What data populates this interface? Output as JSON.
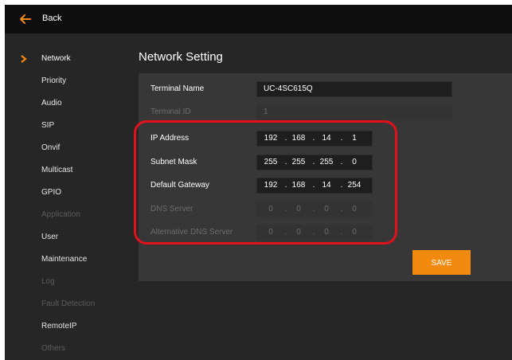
{
  "topbar": {
    "back_label": "Back"
  },
  "sidebar": {
    "items": [
      {
        "label": "Network",
        "state": "active"
      },
      {
        "label": "Priority",
        "state": "normal"
      },
      {
        "label": "Audio",
        "state": "normal"
      },
      {
        "label": "SIP",
        "state": "normal"
      },
      {
        "label": "Onvif",
        "state": "normal"
      },
      {
        "label": "Multicast",
        "state": "normal"
      },
      {
        "label": "GPIO",
        "state": "normal"
      },
      {
        "label": "Application",
        "state": "disabled"
      },
      {
        "label": "User",
        "state": "normal"
      },
      {
        "label": "Maintenance",
        "state": "normal"
      },
      {
        "label": "Log",
        "state": "disabled"
      },
      {
        "label": "Fault Detection",
        "state": "disabled"
      },
      {
        "label": "RemoteIP",
        "state": "normal"
      },
      {
        "label": "Others",
        "state": "disabled"
      }
    ]
  },
  "main": {
    "title": "Network Setting",
    "terminal_name": {
      "label": "Terminal Name",
      "value": "UC-4SC615Q"
    },
    "terminal_id": {
      "label": "Terminal ID",
      "value": "1"
    },
    "ip_address": {
      "label": "IP Address",
      "octets": [
        "192",
        "168",
        "14",
        "1"
      ]
    },
    "subnet_mask": {
      "label": "Subnet Mask",
      "octets": [
        "255",
        "255",
        "255",
        "0"
      ]
    },
    "default_gateway": {
      "label": "Default Gateway",
      "octets": [
        "192",
        "168",
        "14",
        "254"
      ]
    },
    "dns_server": {
      "label": "DNS Server",
      "octets": [
        "0",
        "0",
        "0",
        "0"
      ]
    },
    "alt_dns_server": {
      "label": "Alternative DNS Server",
      "octets": [
        "0",
        "0",
        "0",
        "0"
      ]
    },
    "save_label": "SAVE"
  },
  "colors": {
    "accent": "#f28a10",
    "highlight": "#e0111b",
    "background": "#262626",
    "panel": "#373737"
  }
}
